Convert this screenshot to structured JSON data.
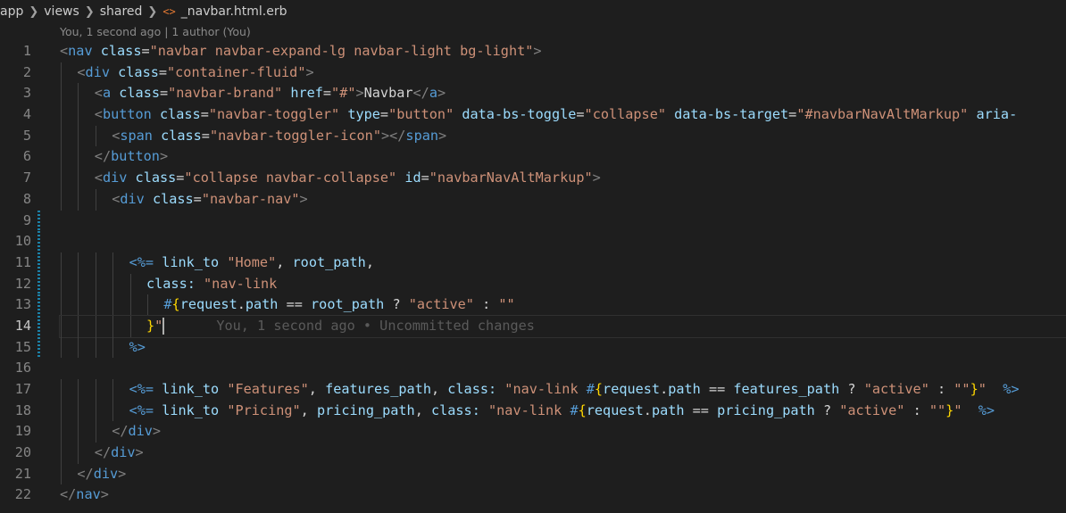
{
  "breadcrumb": {
    "items": [
      "app",
      "views",
      "shared"
    ],
    "file": "_navbar.html.erb",
    "file_icon": "<>"
  },
  "blame_header": "You, 1 second ago | 1 author (You)",
  "inline_blame": "You, 1 second ago • Uncommitted changes",
  "current_line": 14,
  "modified_lines": [
    9,
    10,
    11,
    12,
    13,
    14,
    15
  ],
  "colors": {
    "background": "#1e1e1e",
    "tag": "#569cd6",
    "attribute": "#9cdcfe",
    "string": "#ce9178",
    "interpolation_brace": "#ffd700",
    "gutter_modified": "#1b81a8"
  },
  "lines": [
    {
      "n": "1",
      "indent": 0,
      "tokens": [
        [
          "punc",
          "<"
        ],
        [
          "tag",
          "nav"
        ],
        [
          "text",
          " "
        ],
        [
          "attr",
          "class"
        ],
        [
          "text",
          "="
        ],
        [
          "str",
          "\"navbar navbar-expand-lg navbar-light bg-light\""
        ],
        [
          "punc",
          ">"
        ]
      ]
    },
    {
      "n": "2",
      "indent": 1,
      "tokens": [
        [
          "punc",
          "<"
        ],
        [
          "tag",
          "div"
        ],
        [
          "text",
          " "
        ],
        [
          "attr",
          "class"
        ],
        [
          "text",
          "="
        ],
        [
          "str",
          "\"container-fluid\""
        ],
        [
          "punc",
          ">"
        ]
      ]
    },
    {
      "n": "3",
      "indent": 2,
      "tokens": [
        [
          "punc",
          "<"
        ],
        [
          "tag",
          "a"
        ],
        [
          "text",
          " "
        ],
        [
          "attr",
          "class"
        ],
        [
          "text",
          "="
        ],
        [
          "str",
          "\"navbar-brand\""
        ],
        [
          "text",
          " "
        ],
        [
          "attr",
          "href"
        ],
        [
          "text",
          "="
        ],
        [
          "str",
          "\"#\""
        ],
        [
          "punc",
          ">"
        ],
        [
          "text",
          "Navbar"
        ],
        [
          "punc",
          "</"
        ],
        [
          "tag",
          "a"
        ],
        [
          "punc",
          ">"
        ]
      ]
    },
    {
      "n": "4",
      "indent": 2,
      "tokens": [
        [
          "punc",
          "<"
        ],
        [
          "tag",
          "button"
        ],
        [
          "text",
          " "
        ],
        [
          "attr",
          "class"
        ],
        [
          "text",
          "="
        ],
        [
          "str",
          "\"navbar-toggler\""
        ],
        [
          "text",
          " "
        ],
        [
          "attr",
          "type"
        ],
        [
          "text",
          "="
        ],
        [
          "str",
          "\"button\""
        ],
        [
          "text",
          " "
        ],
        [
          "attr",
          "data-bs-toggle"
        ],
        [
          "text",
          "="
        ],
        [
          "str",
          "\"collapse\""
        ],
        [
          "text",
          " "
        ],
        [
          "attr",
          "data-bs-target"
        ],
        [
          "text",
          "="
        ],
        [
          "str",
          "\"#navbarNavAltMarkup\""
        ],
        [
          "text",
          " "
        ],
        [
          "attr",
          "aria-"
        ]
      ]
    },
    {
      "n": "5",
      "indent": 3,
      "tokens": [
        [
          "punc",
          "<"
        ],
        [
          "tag",
          "span"
        ],
        [
          "text",
          " "
        ],
        [
          "attr",
          "class"
        ],
        [
          "text",
          "="
        ],
        [
          "str",
          "\"navbar-toggler-icon\""
        ],
        [
          "punc",
          "></"
        ],
        [
          "tag",
          "span"
        ],
        [
          "punc",
          ">"
        ]
      ]
    },
    {
      "n": "6",
      "indent": 2,
      "tokens": [
        [
          "punc",
          "</"
        ],
        [
          "tag",
          "button"
        ],
        [
          "punc",
          ">"
        ]
      ]
    },
    {
      "n": "7",
      "indent": 2,
      "tokens": [
        [
          "punc",
          "<"
        ],
        [
          "tag",
          "div"
        ],
        [
          "text",
          " "
        ],
        [
          "attr",
          "class"
        ],
        [
          "text",
          "="
        ],
        [
          "str",
          "\"collapse navbar-collapse\""
        ],
        [
          "text",
          " "
        ],
        [
          "attr",
          "id"
        ],
        [
          "text",
          "="
        ],
        [
          "str",
          "\"navbarNavAltMarkup\""
        ],
        [
          "punc",
          ">"
        ]
      ]
    },
    {
      "n": "8",
      "indent": 3,
      "tokens": [
        [
          "punc",
          "<"
        ],
        [
          "tag",
          "div"
        ],
        [
          "text",
          " "
        ],
        [
          "attr",
          "class"
        ],
        [
          "text",
          "="
        ],
        [
          "str",
          "\"navbar-nav\""
        ],
        [
          "punc",
          ">"
        ]
      ]
    },
    {
      "n": "9",
      "indent": 0,
      "tokens": []
    },
    {
      "n": "10",
      "indent": 0,
      "tokens": []
    },
    {
      "n": "11",
      "indent": 4,
      "tokens": [
        [
          "erb",
          "<%="
        ],
        [
          "text",
          " "
        ],
        [
          "fn",
          "link_to"
        ],
        [
          "text",
          " "
        ],
        [
          "str",
          "\"Home\""
        ],
        [
          "text",
          ", "
        ],
        [
          "fn",
          "root_path"
        ],
        [
          "text",
          ","
        ]
      ]
    },
    {
      "n": "12",
      "indent": 5,
      "tokens": [
        [
          "sym",
          "class:"
        ],
        [
          "text",
          " "
        ],
        [
          "str",
          "\"nav-link"
        ]
      ]
    },
    {
      "n": "13",
      "indent": 6,
      "tokens": [
        [
          "interp",
          "#"
        ],
        [
          "brace",
          "{"
        ],
        [
          "fn",
          "request"
        ],
        [
          "text",
          "."
        ],
        [
          "fn",
          "path"
        ],
        [
          "text",
          " == "
        ],
        [
          "fn",
          "root_path"
        ],
        [
          "text",
          " ? "
        ],
        [
          "str",
          "\"active\""
        ],
        [
          "text",
          " : "
        ],
        [
          "str",
          "\"\""
        ]
      ]
    },
    {
      "n": "14",
      "indent": 5,
      "tokens": [
        [
          "brace",
          "}"
        ],
        [
          "str",
          "\""
        ]
      ]
    },
    {
      "n": "15",
      "indent": 4,
      "tokens": [
        [
          "erb",
          "%>"
        ]
      ]
    },
    {
      "n": "16",
      "indent": 0,
      "tokens": []
    },
    {
      "n": "17",
      "indent": 4,
      "tokens": [
        [
          "erb",
          "<%="
        ],
        [
          "text",
          " "
        ],
        [
          "fn",
          "link_to"
        ],
        [
          "text",
          " "
        ],
        [
          "str",
          "\"Features\""
        ],
        [
          "text",
          ", "
        ],
        [
          "fn",
          "features_path"
        ],
        [
          "text",
          ", "
        ],
        [
          "sym",
          "class:"
        ],
        [
          "text",
          " "
        ],
        [
          "str",
          "\"nav-link "
        ],
        [
          "interp",
          "#"
        ],
        [
          "brace",
          "{"
        ],
        [
          "fn",
          "request"
        ],
        [
          "text",
          "."
        ],
        [
          "fn",
          "path"
        ],
        [
          "text",
          " == "
        ],
        [
          "fn",
          "features_path"
        ],
        [
          "text",
          " ? "
        ],
        [
          "str",
          "\"active\""
        ],
        [
          "text",
          " : "
        ],
        [
          "str",
          "\"\""
        ],
        [
          "brace",
          "}"
        ],
        [
          "str",
          "\""
        ],
        [
          "text",
          "  "
        ],
        [
          "erb",
          "%>"
        ]
      ]
    },
    {
      "n": "18",
      "indent": 4,
      "tokens": [
        [
          "erb",
          "<%="
        ],
        [
          "text",
          " "
        ],
        [
          "fn",
          "link_to"
        ],
        [
          "text",
          " "
        ],
        [
          "str",
          "\"Pricing\""
        ],
        [
          "text",
          ", "
        ],
        [
          "fn",
          "pricing_path"
        ],
        [
          "text",
          ", "
        ],
        [
          "sym",
          "class:"
        ],
        [
          "text",
          " "
        ],
        [
          "str",
          "\"nav-link "
        ],
        [
          "interp",
          "#"
        ],
        [
          "brace",
          "{"
        ],
        [
          "fn",
          "request"
        ],
        [
          "text",
          "."
        ],
        [
          "fn",
          "path"
        ],
        [
          "text",
          " == "
        ],
        [
          "fn",
          "pricing_path"
        ],
        [
          "text",
          " ? "
        ],
        [
          "str",
          "\"active\""
        ],
        [
          "text",
          " : "
        ],
        [
          "str",
          "\"\""
        ],
        [
          "brace",
          "}"
        ],
        [
          "str",
          "\""
        ],
        [
          "text",
          "  "
        ],
        [
          "erb",
          "%>"
        ]
      ]
    },
    {
      "n": "19",
      "indent": 3,
      "tokens": [
        [
          "punc",
          "</"
        ],
        [
          "tag",
          "div"
        ],
        [
          "punc",
          ">"
        ]
      ]
    },
    {
      "n": "20",
      "indent": 2,
      "tokens": [
        [
          "punc",
          "</"
        ],
        [
          "tag",
          "div"
        ],
        [
          "punc",
          ">"
        ]
      ]
    },
    {
      "n": "21",
      "indent": 1,
      "tokens": [
        [
          "punc",
          "</"
        ],
        [
          "tag",
          "div"
        ],
        [
          "punc",
          ">"
        ]
      ]
    },
    {
      "n": "22",
      "indent": 0,
      "tokens": [
        [
          "punc",
          "</"
        ],
        [
          "tag",
          "nav"
        ],
        [
          "punc",
          ">"
        ]
      ]
    }
  ]
}
